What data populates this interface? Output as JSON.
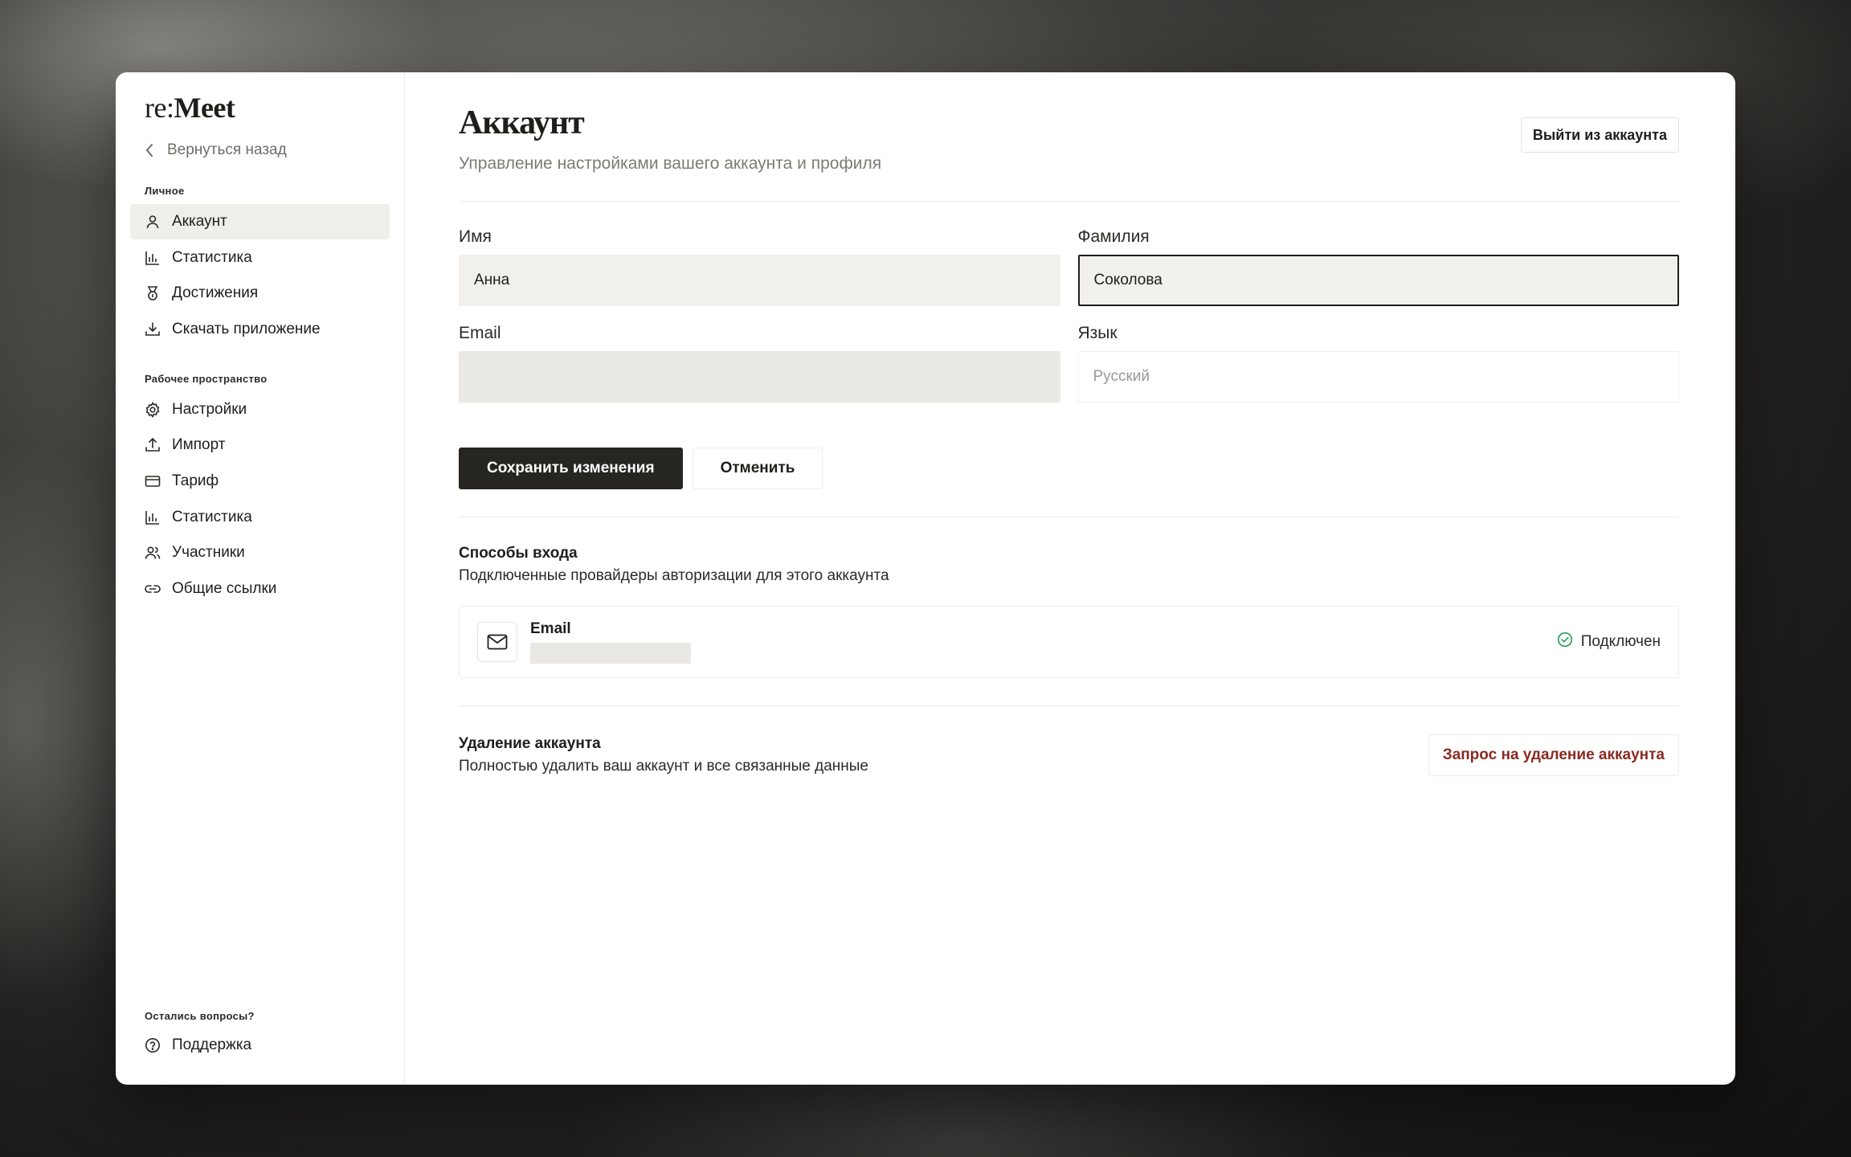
{
  "app": {
    "logo_light": "re:",
    "logo_bold": "Meet"
  },
  "sidebar": {
    "back_label": "Вернуться назад",
    "personal_label": "Личное",
    "personal_items": [
      {
        "label": "Аккаунт",
        "icon": "user-icon",
        "active": true
      },
      {
        "label": "Статистика",
        "icon": "bar-chart-icon"
      },
      {
        "label": "Достижения",
        "icon": "medal-icon"
      },
      {
        "label": "Скачать приложение",
        "icon": "download-icon"
      }
    ],
    "workspace_label": "Рабочее пространство",
    "workspace_items": [
      {
        "label": "Настройки",
        "icon": "gear-icon"
      },
      {
        "label": "Импорт",
        "icon": "upload-icon"
      },
      {
        "label": "Тариф",
        "icon": "credit-card-icon"
      },
      {
        "label": "Статистика",
        "icon": "bar-chart-icon"
      },
      {
        "label": "Участники",
        "icon": "users-icon"
      },
      {
        "label": "Общие ссылки",
        "icon": "link-icon"
      }
    ],
    "help_label": "Остались вопросы?",
    "support_label": "Поддержка"
  },
  "main": {
    "title": "Аккаунт",
    "subtitle": "Управление настройками вашего аккаунта и профиля",
    "logout_label": "Выйти из аккаунта",
    "form": {
      "first_name_label": "Имя",
      "first_name_value": "Анна",
      "last_name_label": "Фамилия",
      "last_name_value": "Соколова",
      "email_label": "Email",
      "email_value": "",
      "language_label": "Язык",
      "language_value": "Русский"
    },
    "save_label": "Сохранить изменения",
    "cancel_label": "Отменить",
    "login_methods": {
      "title": "Способы входа",
      "description": "Подключенные провайдеры авторизации для этого аккаунта",
      "provider_name": "Email",
      "status": "Подключен",
      "status_color": "#2e9e5b"
    },
    "delete": {
      "title": "Удаление аккаунта",
      "description": "Полностью удалить ваш аккаунт и все связанные данные",
      "button_label": "Запрос на удаление аккаунта",
      "button_color": "#8a2a22"
    }
  }
}
